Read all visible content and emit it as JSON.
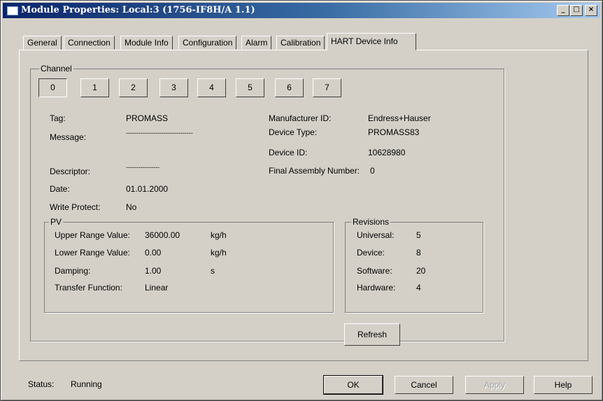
{
  "window": {
    "title": "Module Properties: Local:3 (1756-IF8H/A 1.1)"
  },
  "titlebar_buttons": {
    "minimize": "_",
    "maximize": "□",
    "close": "×"
  },
  "tabs": [
    {
      "label": "General"
    },
    {
      "label": "Connection"
    },
    {
      "label": "Module Info"
    },
    {
      "label": "Configuration"
    },
    {
      "label": "Alarm"
    },
    {
      "label": "Calibration"
    },
    {
      "label": "HART Device Info",
      "active": true
    }
  ],
  "channel": {
    "legend": "Channel",
    "buttons": [
      "0",
      "1",
      "2",
      "3",
      "4",
      "5",
      "6",
      "7"
    ],
    "selected": "0"
  },
  "device": {
    "tag_label": "Tag:",
    "tag_value": "PROMASS",
    "message_label": "Message:",
    "message_value": "--------------------------------",
    "descriptor_label": "Descriptor:",
    "descriptor_value": "----------------",
    "date_label": "Date:",
    "date_value": "01.01.2000",
    "write_protect_label": "Write Protect:",
    "write_protect_value": "No",
    "manufacturer_label": "Manufacturer ID:",
    "manufacturer_value": "Endress+Hauser",
    "device_type_label": "Device Type:",
    "device_type_value": "PROMASS83",
    "device_id_label": "Device ID:",
    "device_id_value": "10628980",
    "final_assembly_label": "Final Assembly Number:",
    "final_assembly_value": "0"
  },
  "pv": {
    "legend": "PV",
    "rows": [
      {
        "label": "Upper Range Value:",
        "value": "36000.00",
        "unit": "kg/h"
      },
      {
        "label": "Lower Range Value:",
        "value": "0.00",
        "unit": "kg/h"
      },
      {
        "label": "Damping:",
        "value": "1.00",
        "unit": "s"
      },
      {
        "label": "Transfer Function:",
        "value": "Linear",
        "unit": ""
      }
    ]
  },
  "revisions": {
    "legend": "Revisions",
    "rows": [
      {
        "label": "Universal:",
        "value": "5"
      },
      {
        "label": "Device:",
        "value": "8"
      },
      {
        "label": "Software:",
        "value": "20"
      },
      {
        "label": "Hardware:",
        "value": "4"
      }
    ]
  },
  "refresh_label": "Refresh",
  "status": {
    "label": "Status:",
    "value": "Running"
  },
  "footer": {
    "ok": "OK",
    "cancel": "Cancel",
    "apply": "Apply",
    "help": "Help"
  },
  "colors": {
    "titlebar_start": "#0a246a",
    "titlebar_end": "#a6caf0",
    "face": "#d4d0c8"
  }
}
